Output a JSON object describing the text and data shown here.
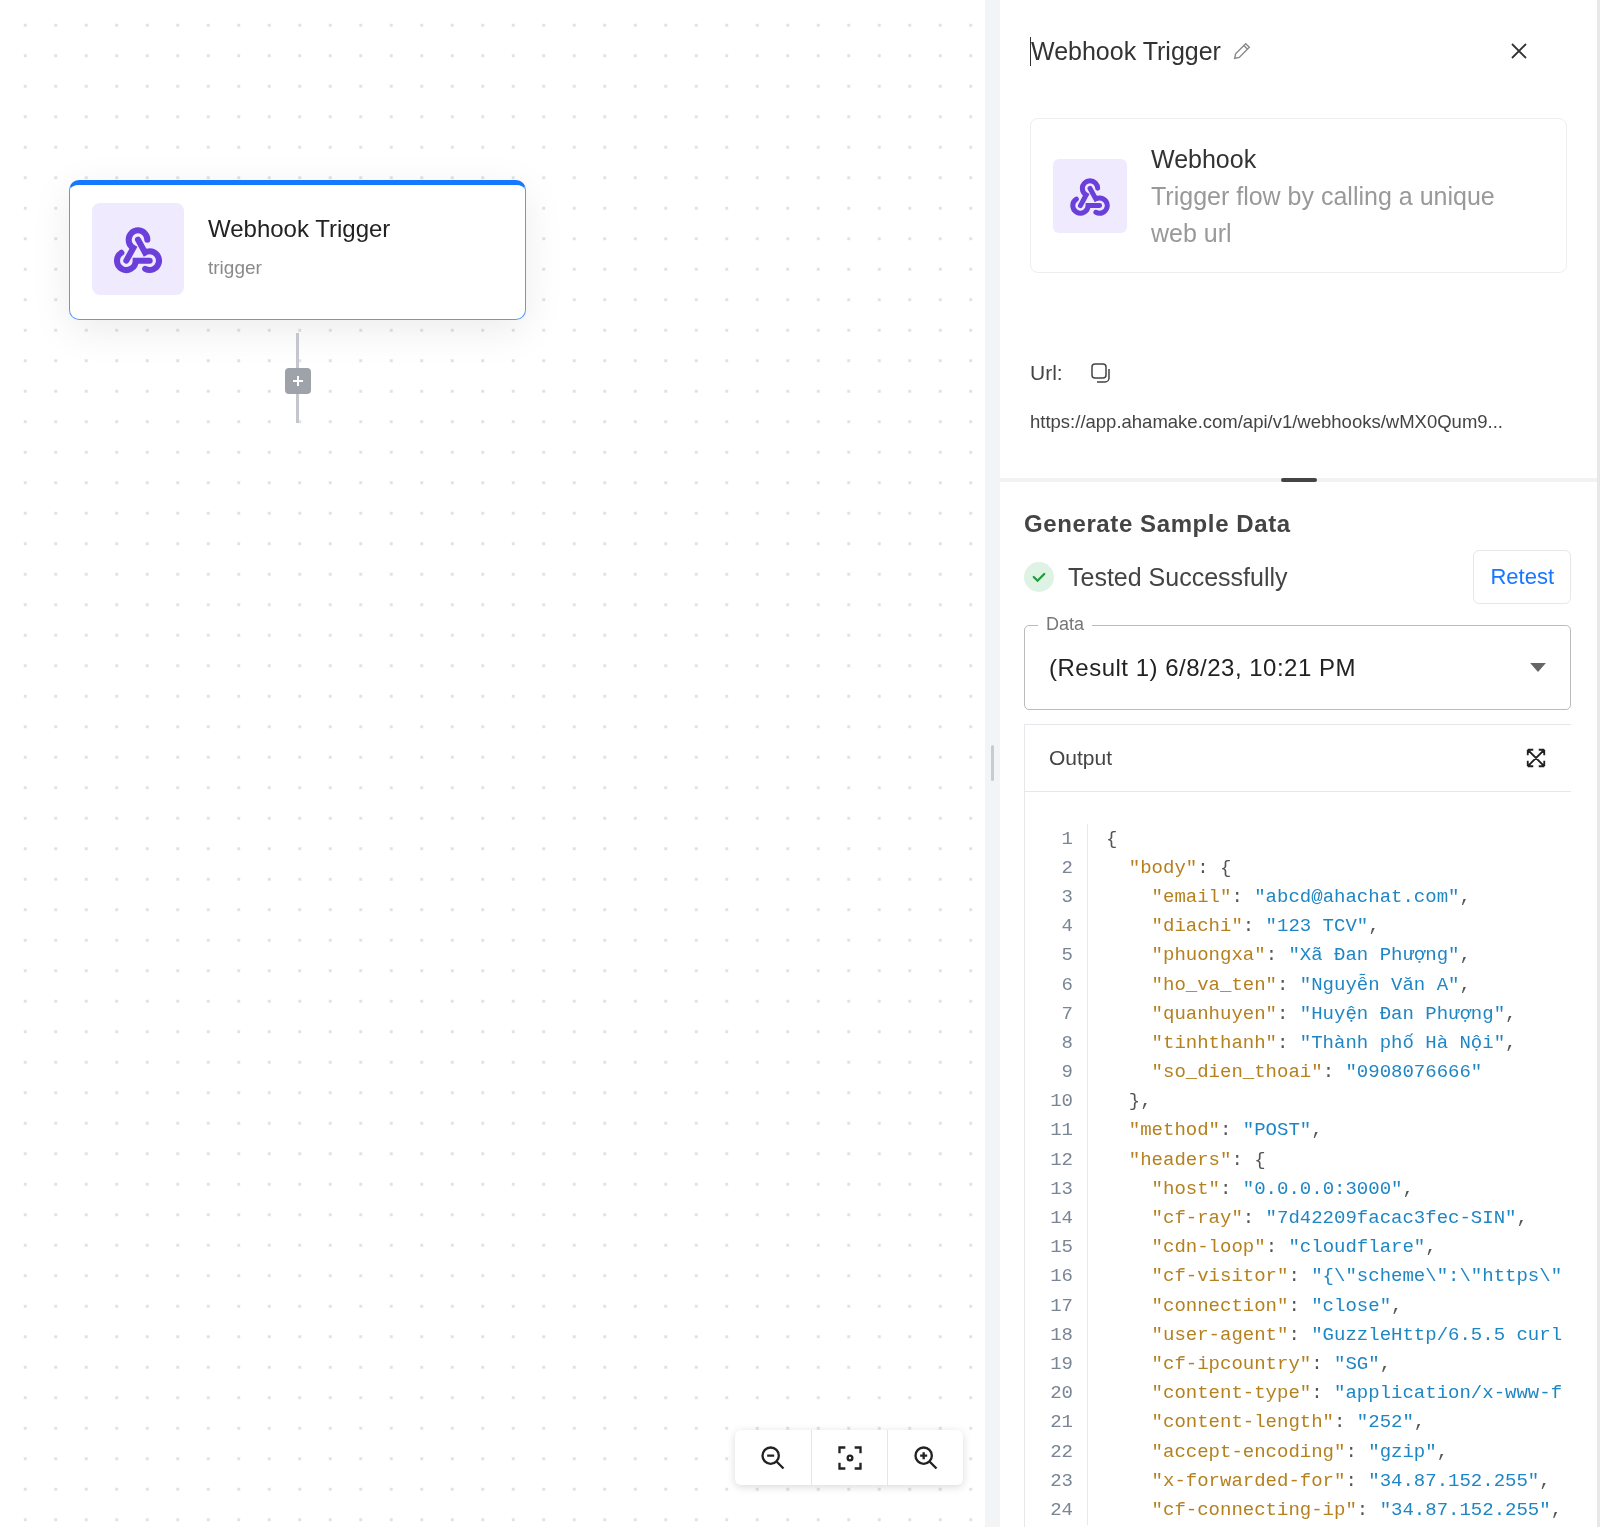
{
  "canvas": {
    "node": {
      "title": "Webhook Trigger",
      "subtitle": "trigger",
      "selected": true
    }
  },
  "panel": {
    "title": "Webhook Trigger",
    "trigger_card": {
      "name": "Webhook",
      "description": "Trigger flow by calling a unique web url"
    },
    "url": {
      "label": "Url:",
      "value": "https://app.ahamake.com/api/v1/webhooks/wMX0Qum9..."
    },
    "sample": {
      "heading": "Generate Sample Data",
      "status": "Tested Successfully",
      "retest_button": "Retest",
      "data_field": {
        "label": "Data",
        "value": "(Result 1) 6/8/23, 10:21 PM"
      },
      "output": {
        "title": "Output",
        "lines": [
          {
            "number": "1",
            "punct": "{",
            "children": [
              {
                "number": "2",
                "key": "\"body\"",
                "sep": ":",
                "punct": "{",
                "children": [
                  {
                    "number": "3",
                    "key": "\"email\"",
                    "sep": ":",
                    "value": "\"abcd@ahachat.com\"",
                    "punct": ","
                  },
                  {
                    "number": "4",
                    "key": "\"diachi\"",
                    "sep": ":",
                    "value": "\"123 TCV\"",
                    "punct": ","
                  },
                  {
                    "number": "5",
                    "key": "\"phuongxa\"",
                    "sep": ":",
                    "value": "\"Xã Đan Phượng\"",
                    "punct": ","
                  },
                  {
                    "number": "6",
                    "key": "\"ho_va_ten\"",
                    "sep": ":",
                    "value": "\"Nguyễn Văn A\"",
                    "punct": ","
                  },
                  {
                    "number": "7",
                    "key": "\"quanhuyen\"",
                    "sep": ":",
                    "value": "\"Huyện Đan Phượng\"",
                    "punct": ","
                  },
                  {
                    "number": "8",
                    "key": "\"tinhthanh\"",
                    "sep": ":",
                    "value": "\"Thành phố Hà Nội\"",
                    "punct": ","
                  },
                  {
                    "number": "9",
                    "key": "\"so_dien_thoai\"",
                    "sep": ":",
                    "value": "\"0908076666\""
                  }
                ]
              },
              {
                "number": "10",
                "punct": "},"
              },
              {
                "number": "11",
                "key": "\"method\"",
                "sep": ":",
                "value": "\"POST\"",
                "punct": ","
              },
              {
                "number": "12",
                "key": "\"headers\"",
                "sep": ":",
                "punct": "{",
                "children": [
                  {
                    "number": "13",
                    "key": "\"host\"",
                    "sep": ":",
                    "value": "\"0.0.0.0:3000\"",
                    "punct": ","
                  },
                  {
                    "number": "14",
                    "key": "\"cf-ray\"",
                    "sep": ":",
                    "value": "\"7d42209facac3fec-SIN\"",
                    "punct": ","
                  },
                  {
                    "number": "15",
                    "key": "\"cdn-loop\"",
                    "sep": ":",
                    "value": "\"cloudflare\"",
                    "punct": ","
                  },
                  {
                    "number": "16",
                    "key": "\"cf-visitor\"",
                    "sep": ":",
                    "value": "\"{\\\"scheme\\\":\\\"https\\\""
                  },
                  {
                    "number": "17",
                    "key": "\"connection\"",
                    "sep": ":",
                    "value": "\"close\"",
                    "punct": ","
                  },
                  {
                    "number": "18",
                    "key": "\"user-agent\"",
                    "sep": ":",
                    "value": "\"GuzzleHttp/6.5.5 curl"
                  },
                  {
                    "number": "19",
                    "key": "\"cf-ipcountry\"",
                    "sep": ":",
                    "value": "\"SG\"",
                    "punct": ","
                  },
                  {
                    "number": "20",
                    "key": "\"content-type\"",
                    "sep": ":",
                    "value": "\"application/x-www-f"
                  },
                  {
                    "number": "21",
                    "key": "\"content-length\"",
                    "sep": ":",
                    "value": "\"252\"",
                    "punct": ","
                  },
                  {
                    "number": "22",
                    "key": "\"accept-encoding\"",
                    "sep": ":",
                    "value": "\"gzip\"",
                    "punct": ","
                  },
                  {
                    "number": "23",
                    "key": "\"x-forwarded-for\"",
                    "sep": ":",
                    "value": "\"34.87.152.255\"",
                    "punct": ","
                  },
                  {
                    "number": "24",
                    "key": "\"cf-connecting-ip\"",
                    "sep": ":",
                    "value": "\"34.87.152.255\"",
                    "punct": ","
                  }
                ]
              }
            ]
          }
        ]
      }
    }
  }
}
